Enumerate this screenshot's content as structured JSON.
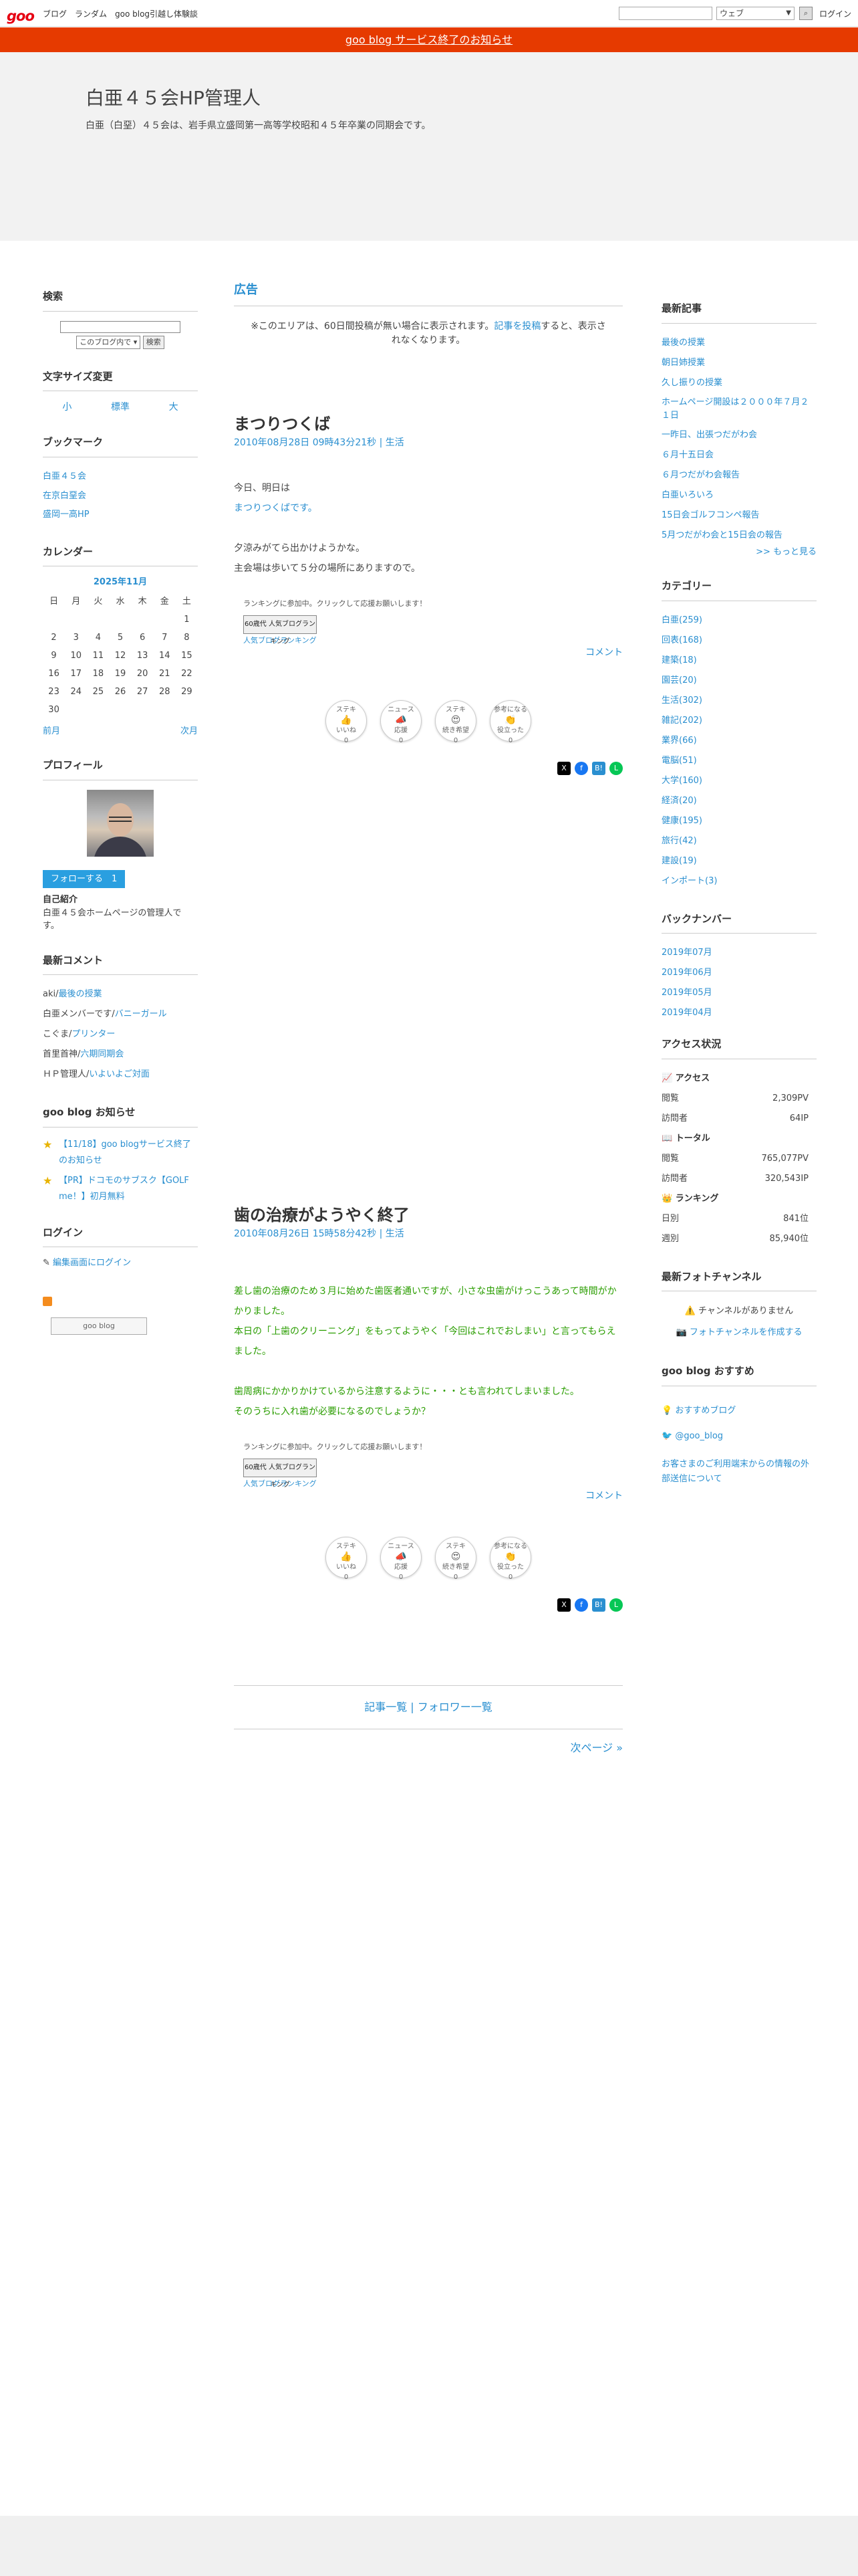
{
  "topbar": {
    "logo": "goo",
    "nav": [
      "ブログ",
      "ランダム",
      "goo blog引越し体験談"
    ],
    "search_select": "ウェブ",
    "login": "ログイン"
  },
  "notice": "goo blog サービス終了のお知らせ",
  "header": {
    "title": "白亜４５会HP管理人",
    "description": "白亜（白堊）４５会は、岩手県立盛岡第一高等学校昭和４５年卒業の同期会です。"
  },
  "left": {
    "search": {
      "title": "検索",
      "select": "このブログ内で",
      "button": "検索"
    },
    "fontsize": {
      "title": "文字サイズ変更",
      "options": [
        "小",
        "標準",
        "大"
      ]
    },
    "bookmark": {
      "title": "ブックマーク",
      "items": [
        "白亜４５会",
        "在京白堊会",
        "盛岡一高HP"
      ]
    },
    "calendar": {
      "title": "カレンダー",
      "month": "2025年11月",
      "weekdays": [
        "日",
        "月",
        "火",
        "水",
        "木",
        "金",
        "土"
      ],
      "weeks": [
        [
          "",
          "",
          "",
          "",
          "",
          "",
          "1"
        ],
        [
          "2",
          "3",
          "4",
          "5",
          "6",
          "7",
          "8"
        ],
        [
          "9",
          "10",
          "11",
          "12",
          "13",
          "14",
          "15"
        ],
        [
          "16",
          "17",
          "18",
          "19",
          "20",
          "21",
          "22"
        ],
        [
          "23",
          "24",
          "25",
          "26",
          "27",
          "28",
          "29"
        ],
        [
          "30",
          "",
          "",
          "",
          "",
          "",
          ""
        ]
      ],
      "prev": "前月",
      "next": "次月"
    },
    "profile": {
      "title": "プロフィール",
      "follow": "フォローする",
      "follow_count": "1",
      "intro_h": "自己紹介",
      "intro": "白亜４５会ホームページの管理人です。"
    },
    "comments": {
      "title": "最新コメント",
      "items": [
        {
          "who": "aki/",
          "link": "最後の授業"
        },
        {
          "who": "白亜メンバーです/",
          "link": "バニーガール"
        },
        {
          "who": "こぐま/",
          "link": "プリンター"
        },
        {
          "who": "首里首神/",
          "link": "六期同期会"
        },
        {
          "who": "ＨＰ管理人/",
          "link": "いよいよご対面"
        }
      ]
    },
    "gooinfo": {
      "title": "goo blog お知らせ",
      "items": [
        "【11/18】goo blogサービス終了のお知らせ",
        "【PR】ドコモのサブスク【GOLF me！】初月無料"
      ]
    },
    "login": {
      "title": "ログイン",
      "link": "編集画面にログイン"
    },
    "badge": "goo blog"
  },
  "main": {
    "ad_title": "広告",
    "ad_note_1": "※このエリアは、60日間投稿が無い場合に表示されます。",
    "ad_note_link": "記事を投稿",
    "ad_note_2": "すると、表示されなくなります。",
    "entries": [
      {
        "title": "まつりつくば",
        "date": "2010年08月28日 09時43分21秒",
        "category": "生活",
        "lines": [
          "今日、明日は",
          "まつりつくばです。",
          "",
          "夕涼みがてら出かけようかな。",
          "主会場は歩いて５分の場所にありますので。"
        ]
      },
      {
        "title": "歯の治療がようやく終了",
        "date": "2010年08月26日 15時58分42秒",
        "category": "生活",
        "lines": [
          "差し歯の治療のため３月に始めた歯医者通いですが、小さな虫歯がけっこうあって時間がかかりました。",
          "本日の「上歯のクリーニング」をもってようやく「今回はこれでおしまい」と言ってもらえました。",
          "",
          "歯周病にかかりかけているから注意するように・・・とも言われてしまいました。",
          "そのうちに入れ歯が必要になるのでしょうか？"
        ]
      }
    ],
    "rank_text": "ランキングに参加中。クリックして応援お願いします！",
    "rank_badge": "60歳代 人気ブログランキング",
    "rank_link": "人気ブログランキング",
    "comment_link": "コメント",
    "reactions": [
      {
        "top": "ステキ",
        "label": "いいね",
        "count": "0"
      },
      {
        "top": "ニュース",
        "label": "応援",
        "count": "0"
      },
      {
        "top": "ステキ",
        "label": "続き希望",
        "count": "0"
      },
      {
        "top": "参考になる",
        "label": "役立った",
        "count": "0"
      }
    ],
    "pager_list": "記事一覧",
    "pager_sep": " | ",
    "pager_follow": "フォロワー一覧",
    "next": "次ページ »"
  },
  "right": {
    "recent": {
      "title": "最新記事",
      "items": [
        "最後の授業",
        "朝日姉授業",
        "久し振りの授業",
        "ホームページ開設は２０００年７月２１日",
        "一昨日、出張つだがわ会",
        "６月十五日会",
        "６月つだがわ会報告",
        "白亜いろいろ",
        "15日会ゴルフコンペ報告",
        "5月つだがわ会と15日会の報告"
      ],
      "more": ">> もっと見る"
    },
    "category": {
      "title": "カテゴリー",
      "items": [
        "白亜(259)",
        "回表(168)",
        "建築(18)",
        "園芸(20)",
        "生活(302)",
        "雑記(202)",
        "業界(66)",
        "電脳(51)",
        "大学(160)",
        "経済(20)",
        "健康(195)",
        "旅行(42)",
        "建設(19)",
        "インポート(3)"
      ]
    },
    "backnumber": {
      "title": "バックナンバー",
      "items": [
        "2019年07月",
        "2019年06月",
        "2019年05月",
        "2019年04月"
      ]
    },
    "access": {
      "title": "アクセス状況",
      "h_access": "アクセス",
      "h_total": "トータル",
      "h_rank": "ランキング",
      "rows1": [
        {
          "k": "閲覧",
          "v": "2,309PV"
        },
        {
          "k": "訪問者",
          "v": "64IP"
        }
      ],
      "rows2": [
        {
          "k": "閲覧",
          "v": "765,077PV"
        },
        {
          "k": "訪問者",
          "v": "320,543IP"
        }
      ],
      "rows3": [
        {
          "k": "日別",
          "v": "841位"
        },
        {
          "k": "週別",
          "v": "85,940位"
        }
      ]
    },
    "photo": {
      "title": "最新フォトチャンネル",
      "none": "チャンネルがありません",
      "create": "フォトチャンネルを作成する"
    },
    "recommend": {
      "title": "goo blog おすすめ",
      "items": [
        "おすすめブログ",
        "@goo_blog",
        "お客さまのご利用端末からの情報の外部送信について"
      ]
    }
  }
}
